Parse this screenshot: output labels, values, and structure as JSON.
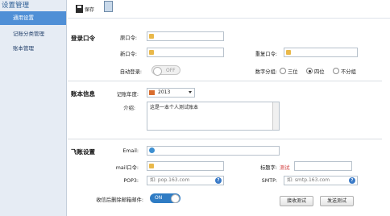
{
  "sidebar": {
    "title": "设置管理",
    "items": [
      {
        "label": "通用设置",
        "active": true
      },
      {
        "label": "记账分类管理",
        "active": false
      },
      {
        "label": "账本管理",
        "active": false
      }
    ]
  },
  "toolbar": {
    "save_label": "保存"
  },
  "login": {
    "title": "登录口令",
    "old_label": "原口令:",
    "new_label": "新口令:",
    "repeat_label": "重复口令:",
    "auto_login_label": "自动登录:",
    "auto_login_state": "OFF",
    "digit_group_label": "数字分组:",
    "options": [
      "三位",
      "四位",
      "不分组"
    ],
    "selected_option": "四位"
  },
  "account": {
    "title": "账本信息",
    "year_label": "记账年度:",
    "year_value": "2013",
    "intro_label": "介绍:",
    "intro_value": "这是一本个人测试账本"
  },
  "email": {
    "title": "飞账设置",
    "email_label": "Email:",
    "mail_pwd_label": "mail口令:",
    "tag_label": "标题字:",
    "tag_value": "测试",
    "pop3_label": "POP3:",
    "pop3_placeholder": "如: pop.163.com",
    "smtp_label": "SMTP:",
    "smtp_placeholder": "如: smtp.163.com",
    "delete_label": "收信后删除邮箱邮件:",
    "delete_state": "ON",
    "receive_test": "接收测试",
    "send_test": "发送测试"
  },
  "colors": {
    "accent": "#4f8fd6",
    "sidebar_bg": "#e6ecf4",
    "toggle_on": "#2f7cc4",
    "tag_red": "#d23c3c"
  }
}
